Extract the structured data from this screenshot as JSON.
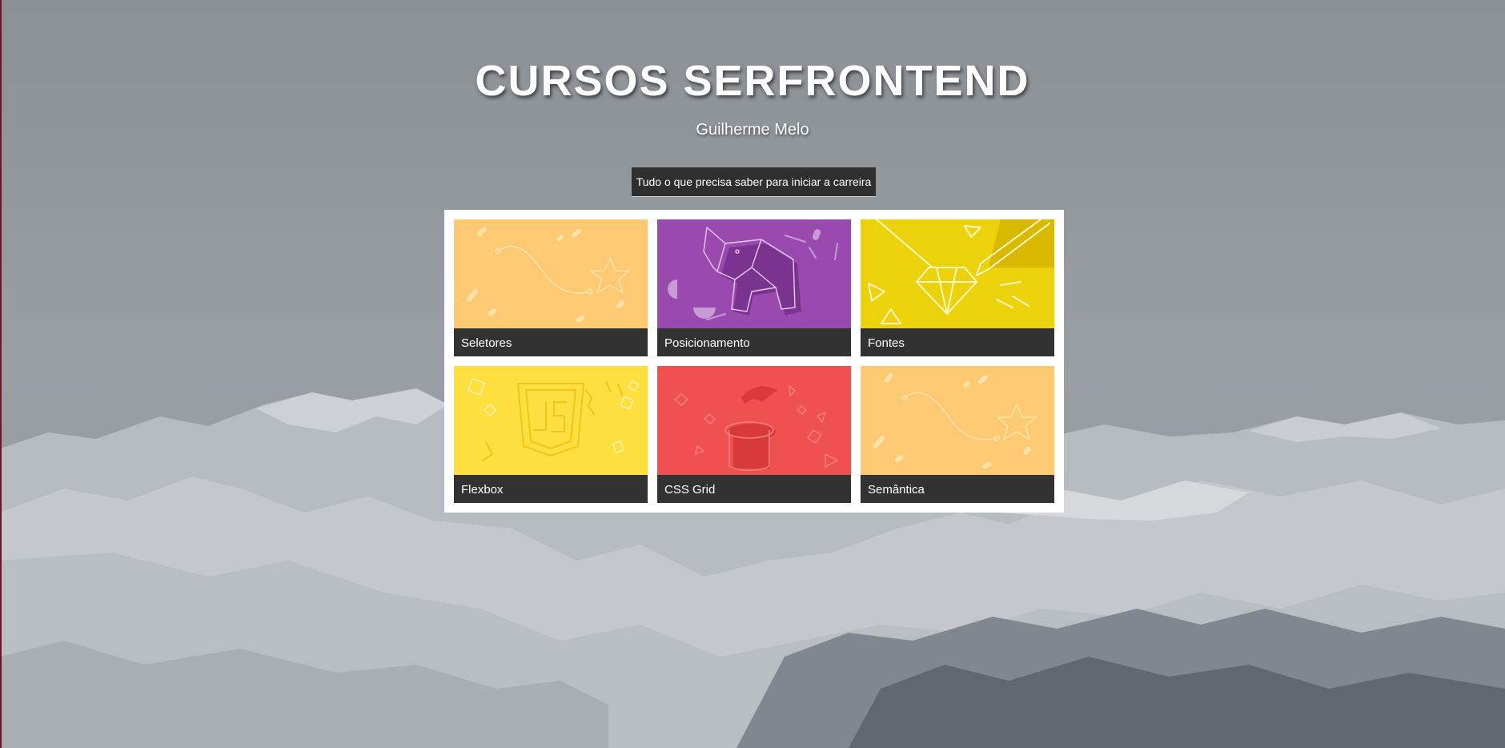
{
  "page": {
    "title": "CURSOS SERFRONTEND",
    "author": "Guilherme Melo",
    "tagline": "Tudo o que precisa saber para iniciar a carreira"
  },
  "courses": [
    {
      "label": "Seletores",
      "color": "#fdc973",
      "icon": "star-path-illustration"
    },
    {
      "label": "Posicionamento",
      "color": "#9a4aae",
      "icon": "origami-elephant-illustration"
    },
    {
      "label": "Fontes",
      "color": "#ecd20a",
      "icon": "diamond-pencil-illustration"
    },
    {
      "label": "Flexbox",
      "color": "#fddf3f",
      "icon": "javascript-shield-illustration"
    },
    {
      "label": "CSS Grid",
      "color": "#ef5050",
      "icon": "magic-hat-illustration"
    },
    {
      "label": "Semântica",
      "color": "#fdc973",
      "icon": "star-path-illustration"
    }
  ],
  "colors": {
    "label_bg": "#323232",
    "grid_bg": "#ffffff",
    "overlay": "#8f9499"
  }
}
